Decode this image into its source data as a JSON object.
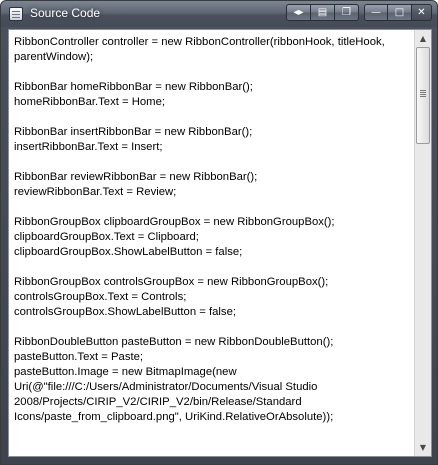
{
  "window": {
    "title": "Source Code",
    "icon": "document-icon",
    "extra_buttons": {
      "back_glyph": "◂▸",
      "print_glyph": "▤",
      "copy_glyph": "❐"
    },
    "controls": {
      "minimize_glyph": "—",
      "maximize_glyph": "□",
      "close_glyph": "✕"
    }
  },
  "code_text": "RibbonController controller = new RibbonController(ribbonHook, titleHook, parentWindow);\n\nRibbonBar homeRibbonBar = new RibbonBar();\nhomeRibbonBar.Text = Home;\n\nRibbonBar insertRibbonBar = new RibbonBar();\ninsertRibbonBar.Text = Insert;\n\nRibbonBar reviewRibbonBar = new RibbonBar();\nreviewRibbonBar.Text = Review;\n\nRibbonGroupBox clipboardGroupBox = new RibbonGroupBox();\nclipboardGroupBox.Text = Clipboard;\nclipboardGroupBox.ShowLabelButton = false;\n\nRibbonGroupBox controlsGroupBox = new RibbonGroupBox();\ncontrolsGroupBox.Text = Controls;\ncontrolsGroupBox.ShowLabelButton = false;\n\nRibbonDoubleButton pasteButton = new RibbonDoubleButton();\npasteButton.Text = Paste;\npasteButton.Image = new BitmapImage(new Uri(@\"file:///C:/Users/Administrator/Documents/Visual Studio 2008/Projects/CIRIP_V2/CIRIP_V2/bin/Release/Standard Icons/paste_from_clipboard.png\", UriKind.RelativeOrAbsolute));",
  "scrollbar": {
    "up_glyph": "▲",
    "down_glyph": "▼",
    "position": 0.0
  },
  "colors": {
    "frame": "#4a505b",
    "close_button": "#525965",
    "text": "#000000"
  }
}
